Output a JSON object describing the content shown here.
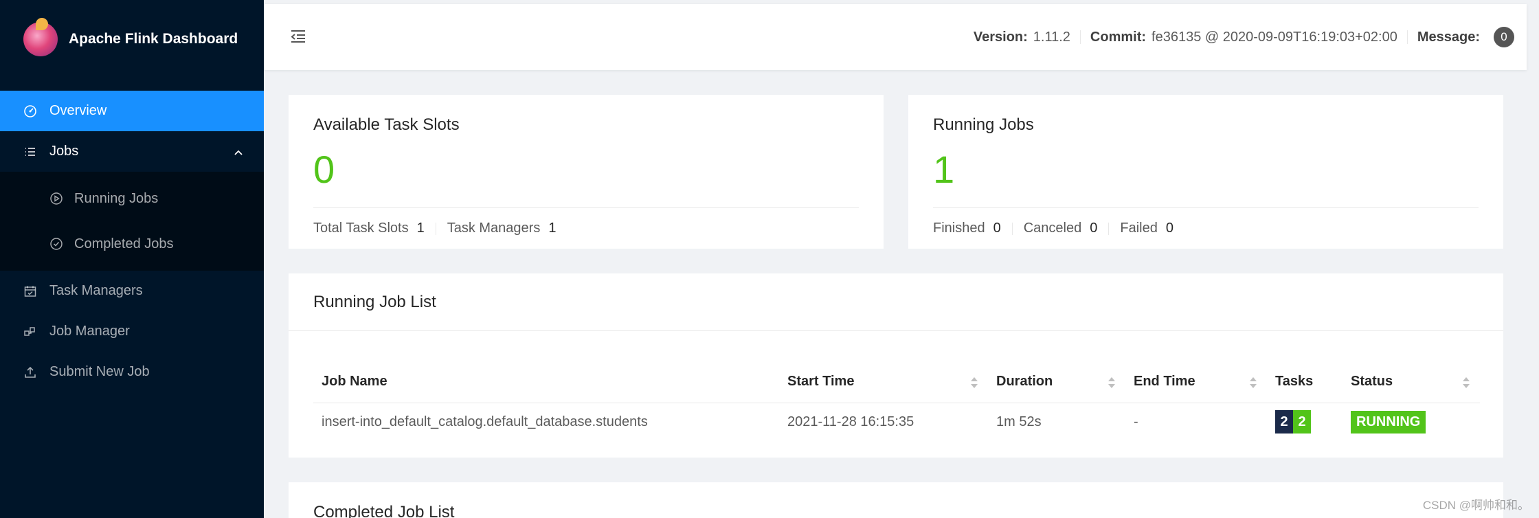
{
  "app": {
    "title": "Apache Flink Dashboard"
  },
  "sidebar": {
    "items": [
      {
        "label": "Overview"
      },
      {
        "label": "Jobs"
      },
      {
        "label": "Task Managers"
      },
      {
        "label": "Job Manager"
      },
      {
        "label": "Submit New Job"
      }
    ],
    "jobs_sub": [
      {
        "label": "Running Jobs"
      },
      {
        "label": "Completed Jobs"
      }
    ]
  },
  "header": {
    "version_label": "Version:",
    "version": "1.11.2",
    "commit_label": "Commit:",
    "commit": "fe36135 @ 2020-09-09T16:19:03+02:00",
    "message_label": "Message:",
    "message_count": "0"
  },
  "task_slots": {
    "title": "Available Task Slots",
    "value": "0",
    "total_label": "Total Task Slots",
    "total": "1",
    "tm_label": "Task Managers",
    "tm": "1"
  },
  "running_jobs": {
    "title": "Running Jobs",
    "value": "1",
    "finished_label": "Finished",
    "finished": "0",
    "canceled_label": "Canceled",
    "canceled": "0",
    "failed_label": "Failed",
    "failed": "0"
  },
  "running_list": {
    "title": "Running Job List",
    "columns": [
      "Job Name",
      "Start Time",
      "Duration",
      "End Time",
      "Tasks",
      "Status"
    ],
    "rows": [
      {
        "name": "insert-into_default_catalog.default_database.students",
        "start": "2021-11-28 16:15:35",
        "duration": "1m 52s",
        "end": "-",
        "tasks_a": "2",
        "tasks_b": "2",
        "status": "RUNNING"
      }
    ]
  },
  "completed_list": {
    "title": "Completed Job List"
  },
  "watermark": "CSDN @啊帅和和。",
  "colors": {
    "sidebar": "#001529",
    "active": "#1890ff",
    "green": "#52c41a",
    "navy": "#1b2a4a"
  }
}
